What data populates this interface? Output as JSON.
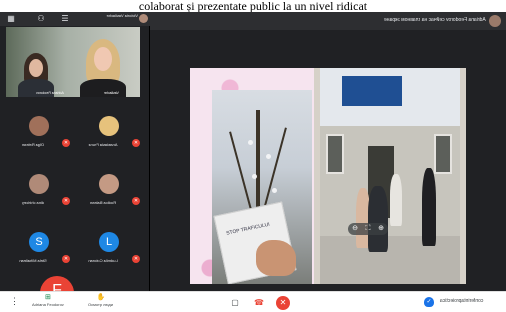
{
  "caption": "colaborat și prezentate public la un nivel ridicat",
  "sidepanel": {
    "header_name": "Victoria Vasilache",
    "header_sub": "a ieșit 5 min",
    "main_video": {
      "left_label": "Adriana Feodorov",
      "right_label": "Vasilache"
    },
    "participants": [
      {
        "name": "Olga Relean",
        "letter": ""
      },
      {
        "name": "Anastasia Frunz",
        "letter": ""
      },
      {
        "name": "dina chiricey",
        "letter": ""
      },
      {
        "name": "Rodica Balean",
        "letter": ""
      },
      {
        "name": "Stela Mihailean",
        "letter": "S"
      },
      {
        "name": "Ludmila Cotoran",
        "letter": "L"
      }
    ],
    "presenter_letter": "F"
  },
  "main": {
    "notice_text": "Adriana Feodorov сейчас на главном экране",
    "slide": {
      "flyer_text": "STOP TRAFICULUI"
    }
  },
  "bottombar": {
    "more": "⋮",
    "present_label": "Adriana Feodorov",
    "people_label": "Осмотр люди",
    "meeting_code": "conferintaproiectica",
    "colors": {
      "mic_off": "#ea4335",
      "shield": "#1a73e8"
    }
  }
}
